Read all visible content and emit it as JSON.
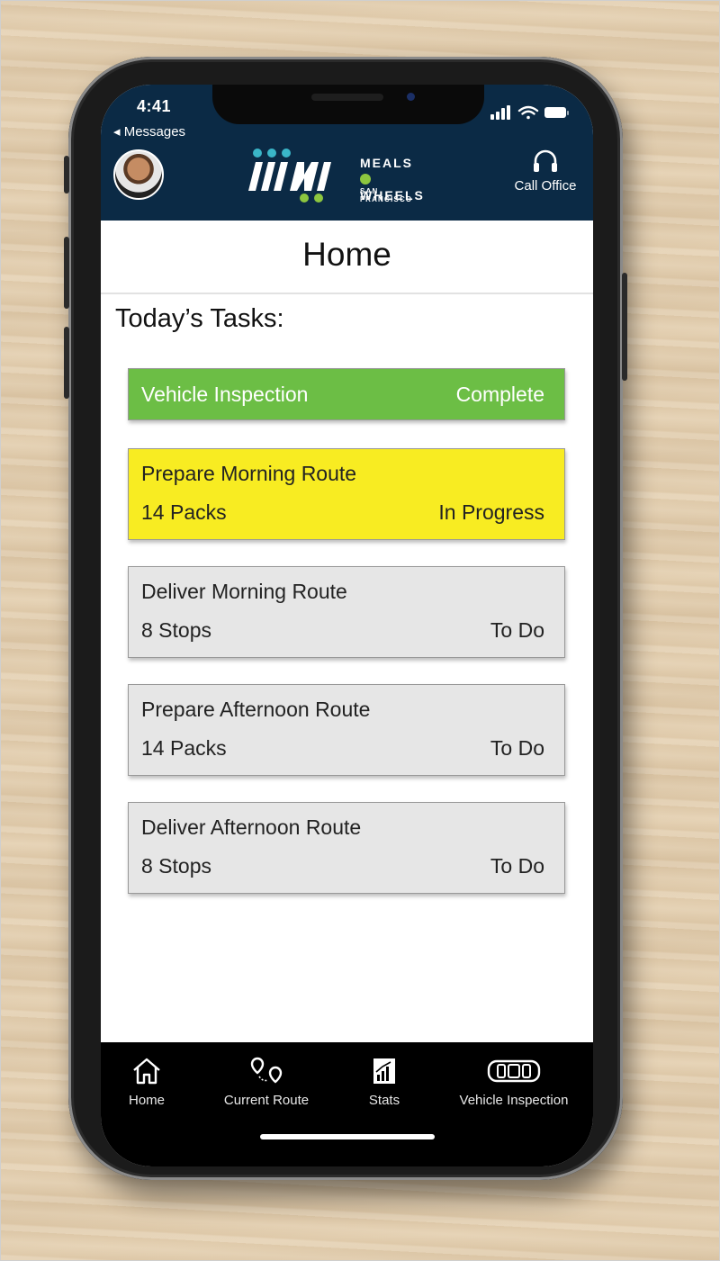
{
  "status_bar": {
    "time": "4:41",
    "back_label": "◂ Messages"
  },
  "header": {
    "logo_line1": "MEALS",
    "logo_line2": "WHEELS",
    "logo_sub": "SAN FRANCISCO",
    "call_label": "Call Office"
  },
  "page": {
    "title": "Home",
    "tasks_heading": "Today’s Tasks:"
  },
  "tasks": [
    {
      "name": "Vehicle Inspection",
      "detail": "",
      "status": "Complete"
    },
    {
      "name": "Prepare Morning Route",
      "detail": "14 Packs",
      "status": "In Progress"
    },
    {
      "name": "Deliver Morning Route",
      "detail": "8 Stops",
      "status": "To Do"
    },
    {
      "name": "Prepare Afternoon Route",
      "detail": "14 Packs",
      "status": "To Do"
    },
    {
      "name": "Deliver Afternoon Route",
      "detail": "8 Stops",
      "status": "To Do"
    }
  ],
  "tabs": [
    {
      "label": "Home",
      "icon": "home-icon"
    },
    {
      "label": "Current Route",
      "icon": "route-icon"
    },
    {
      "label": "Stats",
      "icon": "stats-icon"
    },
    {
      "label": "Vehicle Inspection",
      "icon": "vehicle-icon"
    }
  ],
  "colors": {
    "header": "#0b2a45",
    "complete": "#6cbe45",
    "in_progress": "#f8ec22",
    "todo": "#e6e6e6",
    "logo_accent": "#3ab6c8",
    "logo_green": "#8dc63f"
  }
}
